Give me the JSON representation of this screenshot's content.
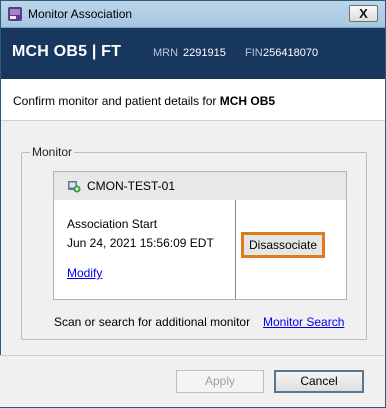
{
  "window": {
    "title": "Monitor Association",
    "close_label": "X",
    "app_icon": "app-window-icon"
  },
  "banner": {
    "patient_name": "MCH OB5 | FT",
    "mrn_label": "MRN",
    "mrn_value": "2291915",
    "fin_label": "FIN",
    "fin_value": "256418070"
  },
  "confirm": {
    "prefix": "Confirm monitor and patient details for ",
    "patient": "MCH OB5"
  },
  "monitor_group": {
    "legend": "Monitor",
    "card": {
      "icon": "monitor-link-icon",
      "monitor_name": "CMON-TEST-01",
      "assoc_label": "Association Start",
      "assoc_time": "Jun 24, 2021 15:56:09 EDT",
      "modify_label": "Modify",
      "disassociate_label": "Disassociate"
    },
    "scan_text": "Scan or search for additional monitor",
    "search_link": "Monitor Search"
  },
  "footer": {
    "apply_label": "Apply",
    "cancel_label": "Cancel"
  },
  "colors": {
    "banner_bg": "#17375e",
    "highlight_border": "#e07b1b",
    "link": "#0000ee"
  }
}
